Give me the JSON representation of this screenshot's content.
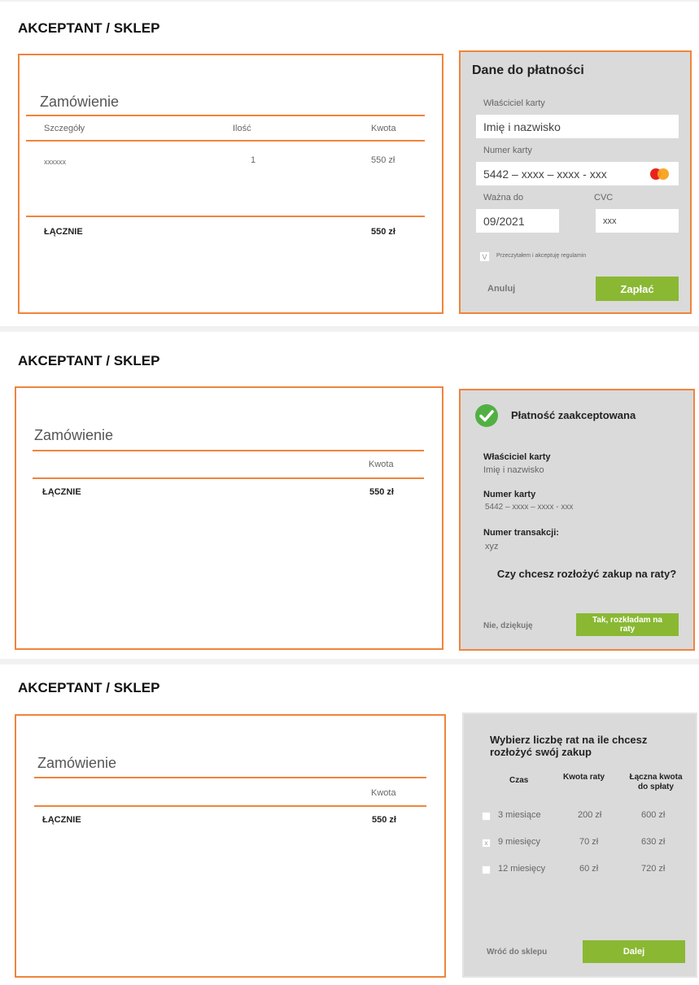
{
  "colors": {
    "accent": "#f0843c",
    "panel": "#dadada",
    "button": "#8ab833"
  },
  "screens": [
    {
      "header": "AKCEPTANT / SKLEP",
      "order": {
        "title": "Zamówienie",
        "columns": [
          "Szczegóły",
          "Ilość",
          "Kwota"
        ],
        "rows": [
          {
            "detail": "xxxxxx",
            "qty": "1",
            "amount": "550 zł"
          }
        ],
        "total_label": "ŁĄCZNIE",
        "total_amount": "550 zł"
      },
      "payment": {
        "title": "Dane do płatności",
        "owner_label": "Właściciel karty",
        "owner_value": "Imię i nazwisko",
        "card_label": "Numer karty",
        "card_value": "5442 – xxxx – xxxx - xxx",
        "card_icon": "mastercard-icon",
        "expiry_label": "Ważna do",
        "expiry_value": "09/2021",
        "cvc_label": "CVC",
        "cvc_value": "xxx",
        "terms_check": "V",
        "terms_label": "Przeczytałem i akceptuję regulamin",
        "cancel_label": "Anuluj",
        "pay_label": "Zapłać"
      }
    },
    {
      "header": "AKCEPTANT / SKLEP",
      "order": {
        "title": "Zamówienie",
        "amount_col": "Kwota",
        "total_label": "ŁĄCZNIE",
        "total_amount": "550 zł"
      },
      "accepted": {
        "status_icon": "check-circle-icon",
        "title": "Płatność zaakceptowana",
        "owner_label": "Właściciel karty",
        "owner_value": "Imię i nazwisko",
        "card_label": "Numer karty",
        "card_value": "5442 – xxxx – xxxx - xxx",
        "txn_label": "Numer transakcji:",
        "txn_value": "xyz",
        "question": "Czy chcesz rozłożyć zakup na raty?",
        "no_label": "Nie, dziękuję",
        "yes_label": "Tak, rozkładam na raty"
      }
    },
    {
      "header": "AKCEPTANT / SKLEP",
      "order": {
        "title": "Zamówienie",
        "amount_col": "Kwota",
        "total_label": "ŁĄCZNIE",
        "total_amount": "550 zł"
      },
      "installments": {
        "title": "Wybierz liczbę rat na ile chcesz rozłożyć swój zakup",
        "columns": [
          "Czas",
          "Kwota raty",
          "Łączna kwota do spłaty"
        ],
        "rows": [
          {
            "check": "",
            "time": "3 miesiące",
            "rate": "200 zł",
            "total": "600 zł"
          },
          {
            "check": "x",
            "time": "9 miesięcy",
            "rate": "70 zł",
            "total": "630 zł"
          },
          {
            "check": "",
            "time": "12 miesięcy",
            "rate": "60 zł",
            "total": "720 zł"
          }
        ],
        "back_label": "Wróć do sklepu",
        "next_label": "Dalej"
      }
    }
  ]
}
